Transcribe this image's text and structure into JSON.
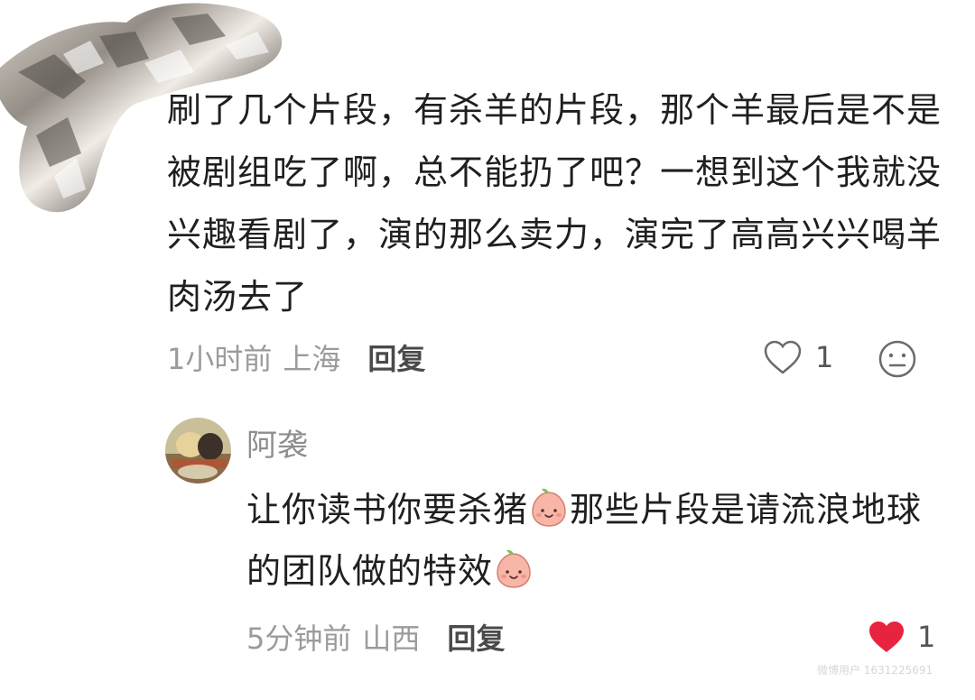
{
  "comment": {
    "text": "刷了几个片段，有杀羊的片段，那个羊最后是不是被剧组吃了啊，总不能扔了吧？一想到这个我就没兴趣看剧了，演的那么卖力，演完了高高兴兴喝羊肉汤去了",
    "time": "1小时前",
    "location": "上海",
    "reply_label": "回复",
    "like_count": "1",
    "like_icon": "heart-outline-icon",
    "dislike_icon": "unhappy-face-icon"
  },
  "reply": {
    "username": "阿袭",
    "text_part1": "让你读书你要杀猪",
    "text_part2": "那些片段是请流浪地球的团队做的特效",
    "emoji_icon": "peach-smile-emoji",
    "time": "5分钟前",
    "location": "山西",
    "reply_label": "回复",
    "like_count": "1",
    "like_icon": "heart-filled-icon",
    "like_color": "#e8233f"
  },
  "watermark": "微博用户 1631225691"
}
